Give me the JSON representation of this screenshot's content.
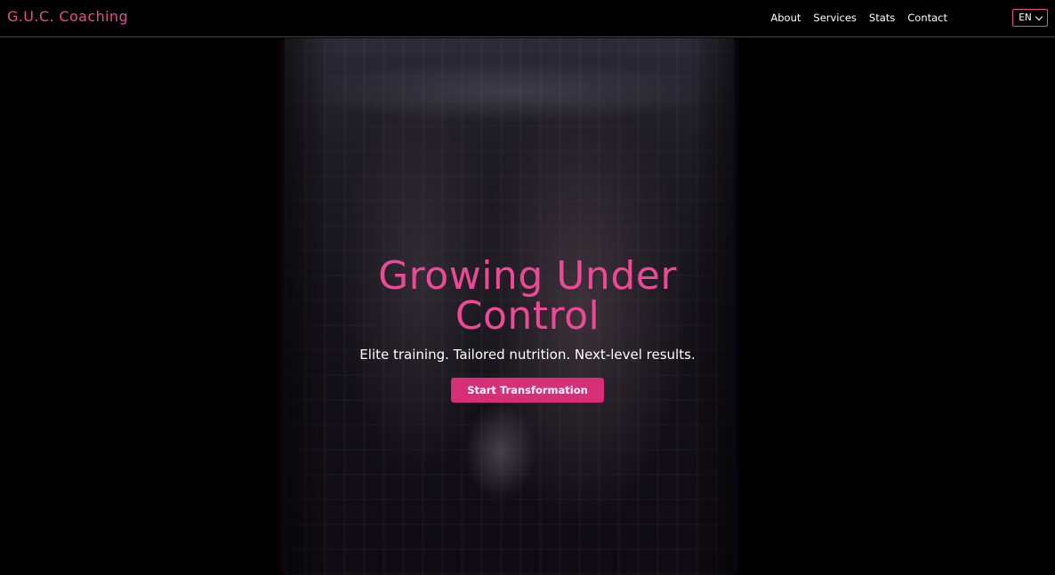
{
  "brand": {
    "logo_text": "G.U.C. Coaching",
    "accent_color": "#ec4a96"
  },
  "nav": {
    "links": [
      {
        "label": "About"
      },
      {
        "label": "Services"
      },
      {
        "label": "Stats"
      },
      {
        "label": "Contact"
      }
    ],
    "language": {
      "selected": "EN",
      "icon": "chevron-down-icon"
    }
  },
  "hero": {
    "title_line1": "Growing Under",
    "title_line2": "Control",
    "subtitle": "Elite training. Tailored nutrition. Next-level results.",
    "cta_label": "Start Transformation",
    "cta_color": "#d62f78"
  }
}
